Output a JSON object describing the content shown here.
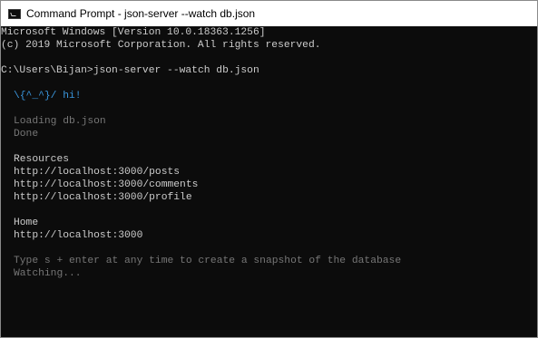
{
  "window": {
    "title": "Command Prompt - json-server  --watch db.json",
    "icon": "console-icon"
  },
  "console": {
    "header": {
      "version_line": "Microsoft Windows [Version 10.0.18363.1256]",
      "copyright_line": "(c) 2019 Microsoft Corporation. All rights reserved."
    },
    "prompt": {
      "path": "C:\\Users\\Bijan>",
      "command": "json-server --watch db.json"
    },
    "greeting": "\\{^_^}/ hi!",
    "loading": "Loading db.json",
    "done": "Done",
    "resources_heading": "Resources",
    "resources": [
      "http://localhost:3000/posts",
      "http://localhost:3000/comments",
      "http://localhost:3000/profile"
    ],
    "home_heading": "Home",
    "home_url": "http://localhost:3000",
    "snapshot_hint": "Type s + enter at any time to create a snapshot of the database",
    "watching": "Watching...",
    "colors": {
      "background": "#0c0c0c",
      "default_text": "#cccccc",
      "greeting": "#3a96dd",
      "muted": "#767676"
    }
  }
}
